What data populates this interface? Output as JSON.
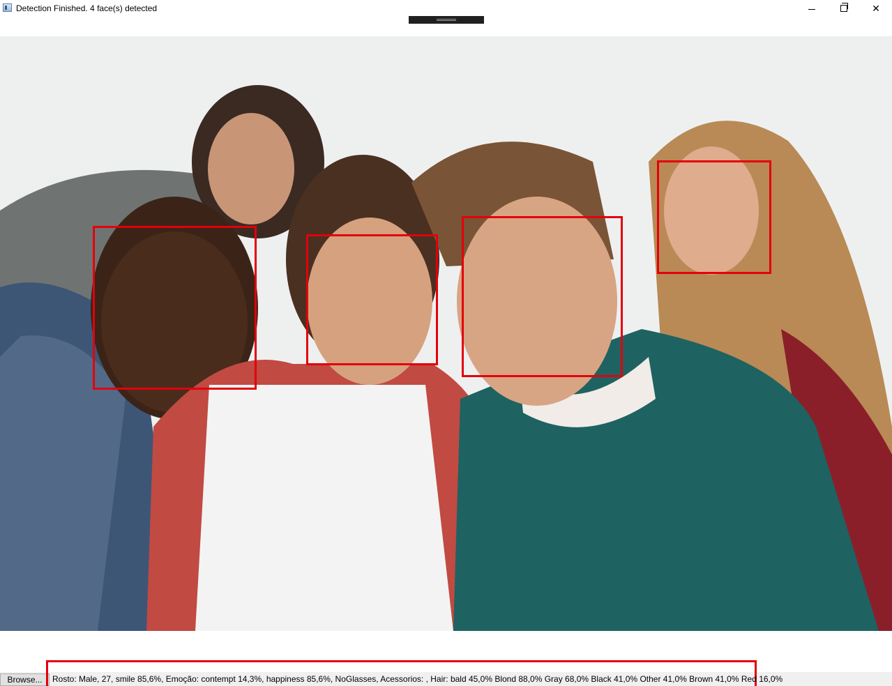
{
  "window": {
    "title": "Detection Finished. 4 face(s) detected",
    "icons": {
      "app": "window-app-icon",
      "minimize": "minimize-icon",
      "maximize": "restore-icon",
      "close": "close-icon"
    },
    "close_glyph": "✕"
  },
  "photo": {
    "description_icon": "group-selfie-photo"
  },
  "detection": {
    "face_count": 4,
    "box_color": "#e3000b"
  },
  "bottom": {
    "browse_label": "Browse...",
    "result_text": "Rosto: Male, 27, smile 85,6%, Emoção: contempt 14,3%, happiness 85,6%, NoGlasses, Acessorios: , Hair: bald 45,0% Blond 88,0% Gray 68,0% Black 41,0% Other 41,0% Brown 41,0% Red 16,0%"
  }
}
